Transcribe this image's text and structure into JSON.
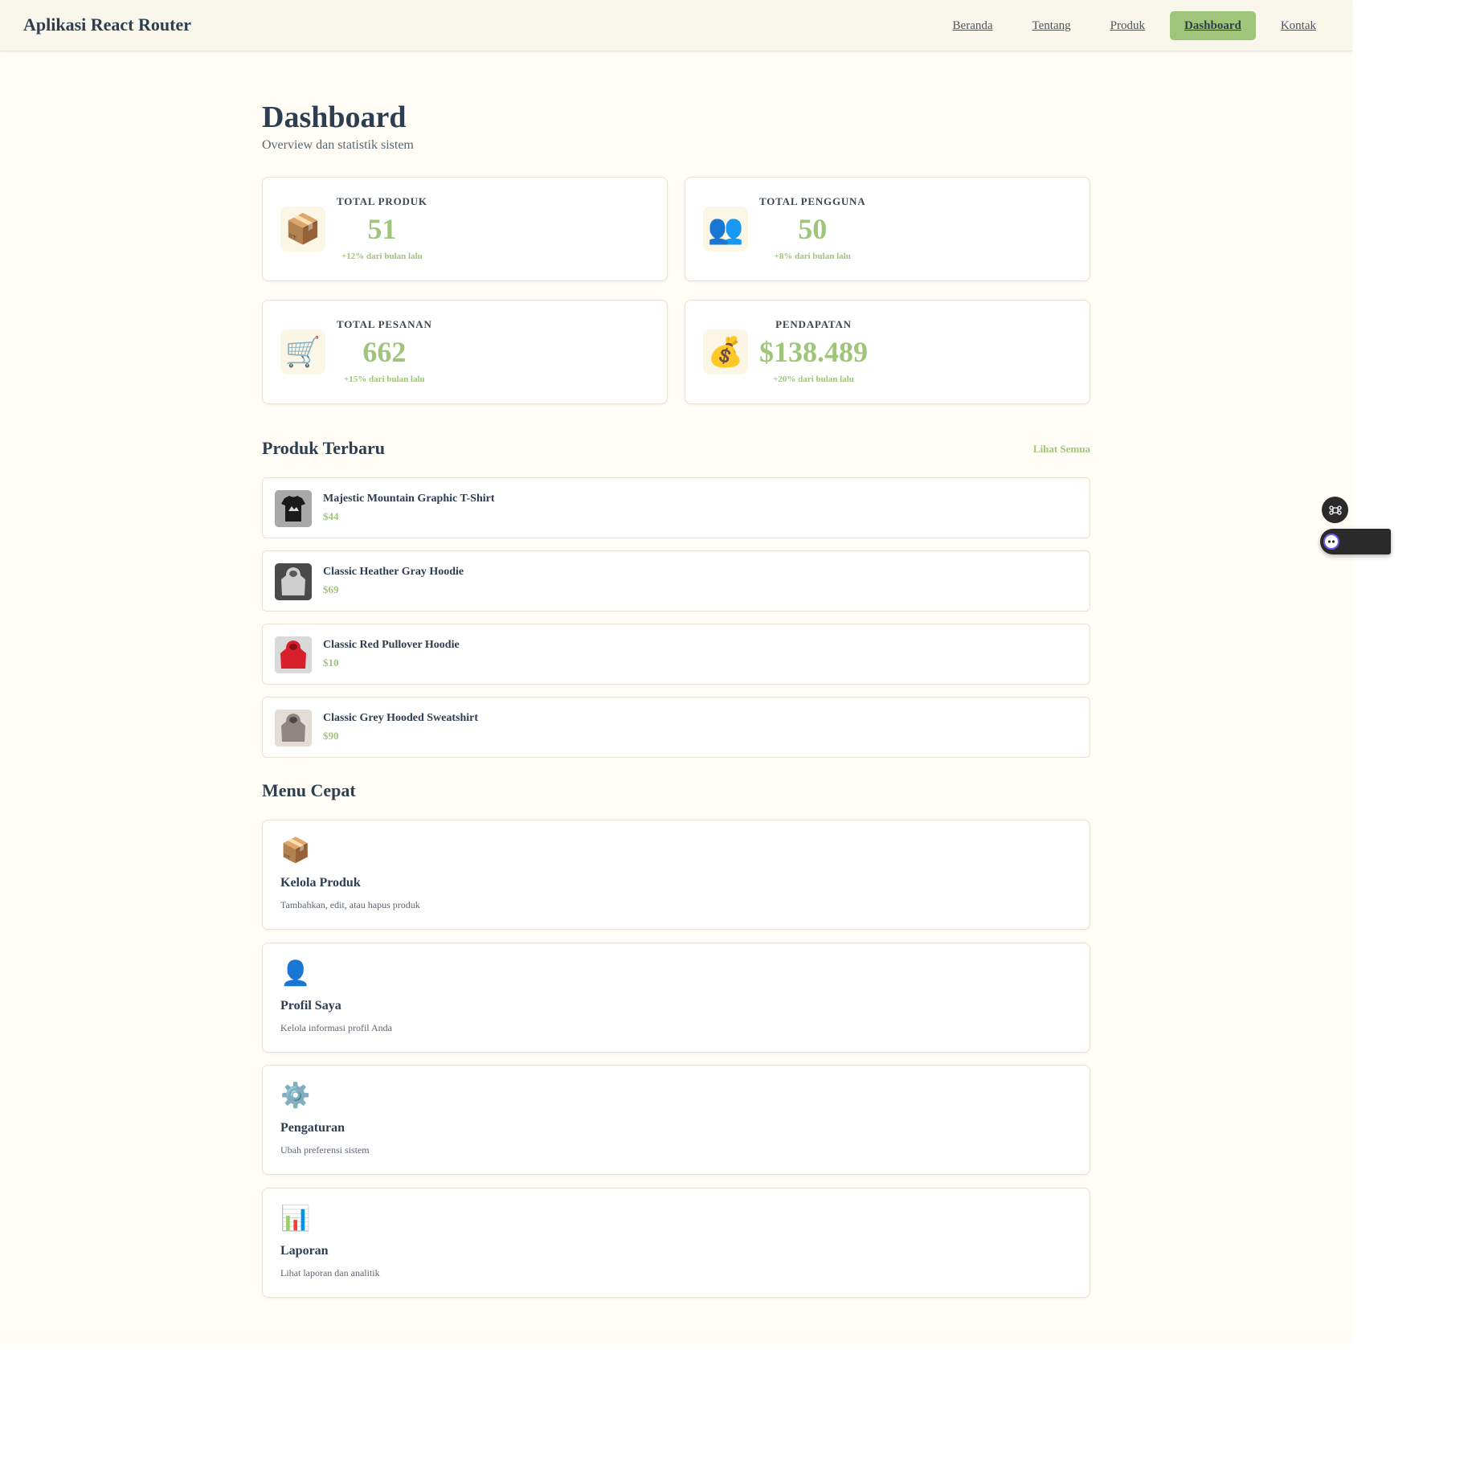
{
  "navbar": {
    "brand": "Aplikasi React Router",
    "links": [
      {
        "label": "Beranda",
        "active": false
      },
      {
        "label": "Tentang",
        "active": false
      },
      {
        "label": "Produk",
        "active": false
      },
      {
        "label": "Dashboard",
        "active": true
      },
      {
        "label": "Kontak",
        "active": false
      }
    ]
  },
  "page": {
    "title": "Dashboard",
    "subtitle": "Overview dan statistik sistem"
  },
  "stats": [
    {
      "icon": "package-icon",
      "glyph": "📦",
      "label": "TOTAL PRODUK",
      "value": "51",
      "change": "+12% dari bulan lalu"
    },
    {
      "icon": "users-icon",
      "glyph": "👥",
      "label": "TOTAL PENGGUNA",
      "value": "50",
      "change": "+8% dari bulan lalu"
    },
    {
      "icon": "cart-icon",
      "glyph": "🛒",
      "label": "TOTAL PESANAN",
      "value": "662",
      "change": "+15% dari bulan lalu"
    },
    {
      "icon": "money-bag-icon",
      "glyph": "💰",
      "label": "PENDAPATAN",
      "value": "$138.489",
      "change": "+20% dari bulan lalu"
    }
  ],
  "latest_products": {
    "title": "Produk Terbaru",
    "see_all": "Lihat Semua",
    "items": [
      {
        "name": "Majestic Mountain Graphic T-Shirt",
        "price": "$44"
      },
      {
        "name": "Classic Heather Gray Hoodie",
        "price": "$69"
      },
      {
        "name": "Classic Red Pullover Hoodie",
        "price": "$10"
      },
      {
        "name": "Classic Grey Hooded Sweatshirt",
        "price": "$90"
      }
    ]
  },
  "quick_menu": {
    "title": "Menu Cepat",
    "items": [
      {
        "icon": "package-icon",
        "glyph": "📦",
        "title": "Kelola Produk",
        "desc": "Tambahkan, edit, atau hapus produk"
      },
      {
        "icon": "user-icon",
        "glyph": "👤",
        "title": "Profil Saya",
        "desc": "Kelola informasi profil Anda"
      },
      {
        "icon": "gear-icon",
        "glyph": "⚙️",
        "title": "Pengaturan",
        "desc": "Ubah preferensi sistem"
      },
      {
        "icon": "bar-chart-icon",
        "glyph": "📊",
        "title": "Laporan",
        "desc": "Lihat laporan dan analitik"
      }
    ]
  },
  "colors": {
    "accent": "#9fc57b",
    "text": "#2c3e50",
    "background": "#fffdf5",
    "navbar": "#f9f6ec"
  }
}
